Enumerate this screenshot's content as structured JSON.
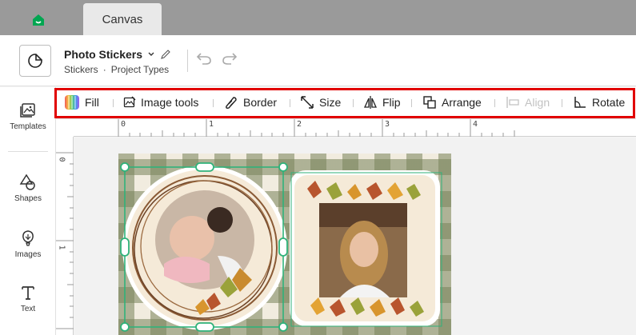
{
  "tabs": {
    "home_icon": "home-icon",
    "canvas_label": "Canvas"
  },
  "project": {
    "title": "Photo Stickers",
    "breadcrumb_1": "Stickers",
    "breadcrumb_sep": "·",
    "breadcrumb_2": "Project Types"
  },
  "sidebar": {
    "items": [
      {
        "label": "Templates",
        "icon": "templates-icon"
      },
      {
        "label": "Shapes",
        "icon": "shapes-icon"
      },
      {
        "label": "Images",
        "icon": "images-icon"
      },
      {
        "label": "Text",
        "icon": "text-icon"
      }
    ]
  },
  "toolbar": {
    "fill": "Fill",
    "image_tools": "Image tools",
    "border": "Border",
    "size": "Size",
    "flip": "Flip",
    "arrange": "Arrange",
    "align": "Align",
    "rotate": "Rotate",
    "align_disabled": true
  },
  "ruler": {
    "top_labels": [
      "0",
      "1",
      "2",
      "3",
      "4"
    ],
    "left_labels": [
      "0",
      "1"
    ]
  },
  "colors": {
    "highlight": "#e10000",
    "selection": "#2fb27a",
    "brand": "#00a651",
    "mat_check": "#7c8a5e",
    "mat_base": "#f1ecdf"
  }
}
